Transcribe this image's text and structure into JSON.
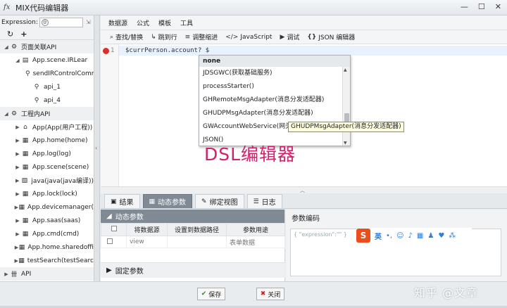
{
  "window": {
    "title": "MIX代码编辑器",
    "minimize": "—",
    "maximize": "☐",
    "close": "✕"
  },
  "left": {
    "expression_label": "Expression:",
    "expression_value": "",
    "tree": [
      {
        "label": "页面关联API",
        "level": 1,
        "arrow": "◢",
        "icon": "⚙",
        "section": true
      },
      {
        "label": "App.scene.IRLear",
        "level": 2,
        "arrow": "◢",
        "icon": "▤"
      },
      {
        "label": "sendIRControlComm",
        "level": 3,
        "arrow": "",
        "icon": "⚲"
      },
      {
        "label": "api_1",
        "level": 3,
        "arrow": "",
        "icon": "⚲"
      },
      {
        "label": "api_4",
        "level": 3,
        "arrow": "",
        "icon": "⚲"
      },
      {
        "label": "工程内API",
        "level": 1,
        "arrow": "◢",
        "icon": "⚙",
        "section": true
      },
      {
        "label": "App(App(用户工程))",
        "level": 2,
        "arrow": "▶",
        "icon": "⌂"
      },
      {
        "label": "App.home(home)",
        "level": 2,
        "arrow": "▶",
        "icon": "▦"
      },
      {
        "label": "App.log(log)",
        "level": 2,
        "arrow": "▶",
        "icon": "▦"
      },
      {
        "label": "App.scene(scene)",
        "level": 2,
        "arrow": "▶",
        "icon": "▦"
      },
      {
        "label": "java(java(java编译))",
        "level": 2,
        "arrow": "▶",
        "icon": "▧"
      },
      {
        "label": "App.lock(lock)",
        "level": 2,
        "arrow": "▶",
        "icon": "▦"
      },
      {
        "label": "App.devicemanager(",
        "level": 2,
        "arrow": "▶",
        "icon": "▦"
      },
      {
        "label": "App.saas(saas)",
        "level": 2,
        "arrow": "▶",
        "icon": "▦"
      },
      {
        "label": "App.cmd(cmd)",
        "level": 2,
        "arrow": "▶",
        "icon": "▦"
      },
      {
        "label": "App.home.sharedoffi",
        "level": 2,
        "arrow": "▶",
        "icon": "▦"
      },
      {
        "label": "testSearch(testSearc",
        "level": 2,
        "arrow": "▶",
        "icon": "▦"
      },
      {
        "label": "API",
        "level": 1,
        "arrow": "▶",
        "icon": "卌",
        "section": true
      }
    ]
  },
  "menu": [
    "数据源",
    "公式",
    "模板",
    "工具"
  ],
  "toolbar": [
    {
      "icon": "⌕",
      "label": "查找/替换"
    },
    {
      "icon": "↳",
      "label": "跳到行"
    },
    {
      "icon": "≡",
      "label": "调整缩进"
    },
    {
      "icon": "</>",
      "label": "JavaScript"
    },
    {
      "icon": "▶",
      "label": "调试"
    },
    {
      "icon": "{}",
      "label": "JSON 编辑器"
    }
  ],
  "editor": {
    "line_number": "1",
    "code": "$currPerson.account? $",
    "overlay_text": "DSL编辑器"
  },
  "autocomplete": {
    "header": "none",
    "items": [
      "JDSGWC(获取基础服务)",
      "processStarter()",
      "GHRemoteMsgAdapter(消息分发适配器)",
      "GHUDPMsgAdapter(消息分发适配器)",
      "GWAccountWebService(网关认证服务)",
      "JSON()"
    ],
    "tooltip": "GHUDPMsgAdapter(消息分发适配器)"
  },
  "tabs": [
    {
      "label": "结果",
      "icon": "▣",
      "active": false
    },
    {
      "label": "动态参数",
      "icon": "▦",
      "active": true
    },
    {
      "label": "绑定视图",
      "icon": "✎",
      "active": false
    },
    {
      "label": "日志",
      "icon": "☰",
      "active": false
    }
  ],
  "params": {
    "title": "动态参数",
    "columns": [
      "",
      "将数据源",
      "设置到数据路径",
      "参数用途"
    ],
    "rows": [
      {
        "source": "view",
        "path": "",
        "use": "表单数据"
      }
    ],
    "fixed_title": "固定参数"
  },
  "encode": {
    "title": "参数编码",
    "placeholder": "{ \"expression\":\"\" }"
  },
  "ime": {
    "logo": "S",
    "lang": "英",
    "icons": [
      "•,",
      "☺",
      "♪",
      "▦",
      "♟",
      "♥",
      "⁂"
    ]
  },
  "footer": {
    "save": "保存",
    "close": "关闭",
    "watermark": "知乎 @文章"
  }
}
